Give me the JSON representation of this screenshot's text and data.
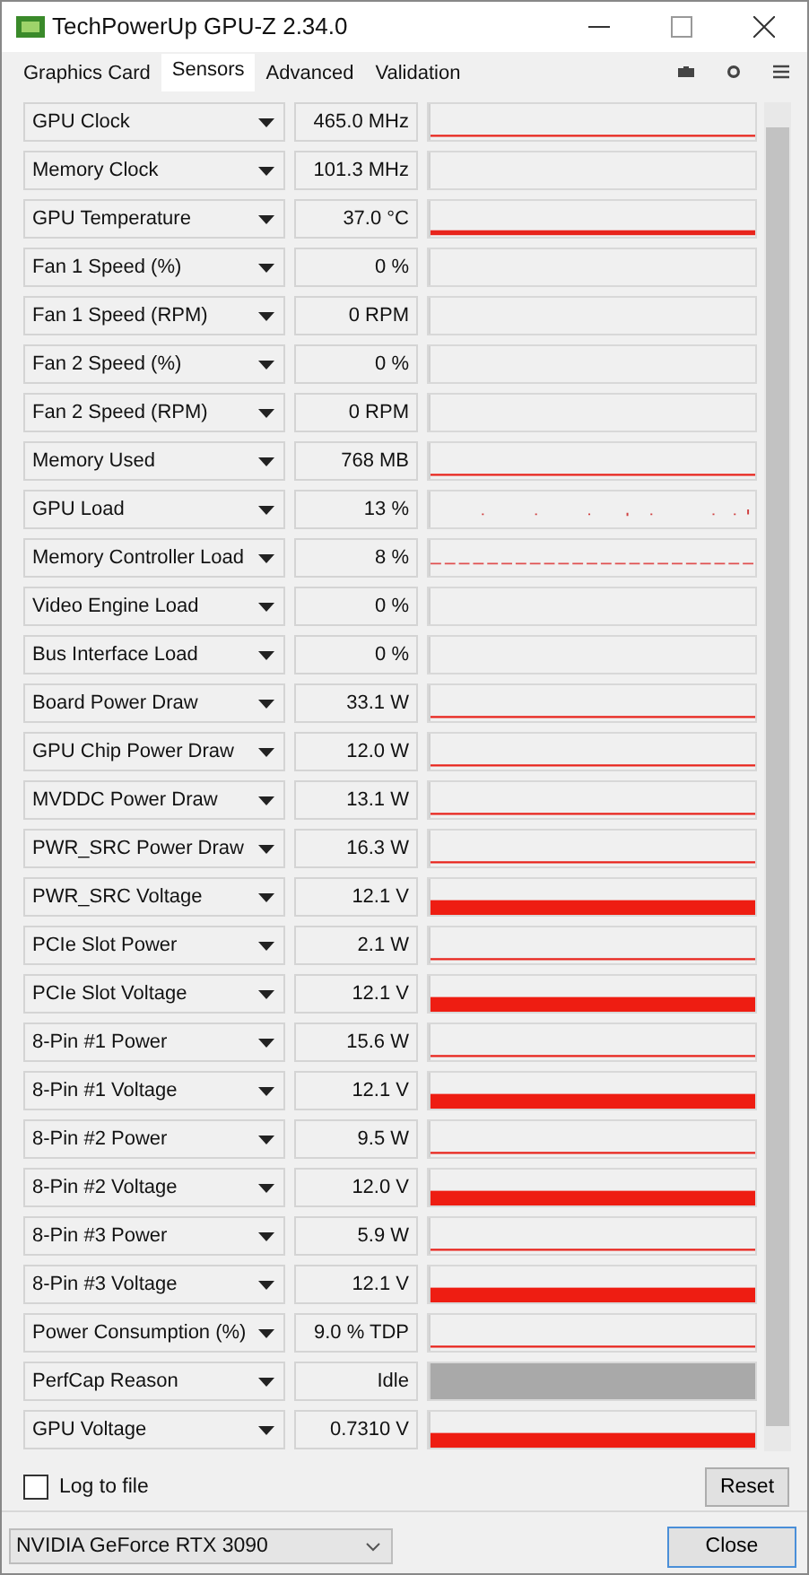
{
  "window": {
    "title": "TechPowerUp GPU-Z 2.34.0"
  },
  "tabs": [
    {
      "label": "Graphics Card",
      "selected": false
    },
    {
      "label": "Sensors",
      "selected": true
    },
    {
      "label": "Advanced",
      "selected": false
    },
    {
      "label": "Validation",
      "selected": false
    }
  ],
  "sensors": [
    {
      "name": "GPU Clock",
      "value": "465.0 MHz",
      "kind": "line"
    },
    {
      "name": "Memory Clock",
      "value": "101.3 MHz",
      "kind": "empty"
    },
    {
      "name": "GPU Temperature",
      "value": "37.0 °C",
      "kind": "thick"
    },
    {
      "name": "Fan 1 Speed (%)",
      "value": "0 %",
      "kind": "empty"
    },
    {
      "name": "Fan 1 Speed (RPM)",
      "value": "0 RPM",
      "kind": "empty"
    },
    {
      "name": "Fan 2 Speed (%)",
      "value": "0 %",
      "kind": "empty"
    },
    {
      "name": "Fan 2 Speed (RPM)",
      "value": "0 RPM",
      "kind": "empty"
    },
    {
      "name": "Memory Used",
      "value": "768 MB",
      "kind": "line"
    },
    {
      "name": "GPU Load",
      "value": "13 %",
      "kind": "dots"
    },
    {
      "name": "Memory Controller Load",
      "value": "8 %",
      "kind": "dashes"
    },
    {
      "name": "Video Engine Load",
      "value": "0 %",
      "kind": "empty"
    },
    {
      "name": "Bus Interface Load",
      "value": "0 %",
      "kind": "empty"
    },
    {
      "name": "Board Power Draw",
      "value": "33.1 W",
      "kind": "line"
    },
    {
      "name": "GPU Chip Power Draw",
      "value": "12.0 W",
      "kind": "line"
    },
    {
      "name": "MVDDC Power Draw",
      "value": "13.1 W",
      "kind": "line"
    },
    {
      "name": "PWR_SRC Power Draw",
      "value": "16.3 W",
      "kind": "line"
    },
    {
      "name": "PWR_SRC Voltage",
      "value": "12.1 V",
      "kind": "bar"
    },
    {
      "name": "PCIe Slot Power",
      "value": "2.1 W",
      "kind": "line"
    },
    {
      "name": "PCIe Slot Voltage",
      "value": "12.1 V",
      "kind": "bar"
    },
    {
      "name": "8-Pin #1 Power",
      "value": "15.6 W",
      "kind": "line"
    },
    {
      "name": "8-Pin #1 Voltage",
      "value": "12.1 V",
      "kind": "bar"
    },
    {
      "name": "8-Pin #2 Power",
      "value": "9.5 W",
      "kind": "line"
    },
    {
      "name": "8-Pin #2 Voltage",
      "value": "12.0 V",
      "kind": "bar"
    },
    {
      "name": "8-Pin #3 Power",
      "value": "5.9 W",
      "kind": "line"
    },
    {
      "name": "8-Pin #3 Voltage",
      "value": "12.1 V",
      "kind": "bar"
    },
    {
      "name": "Power Consumption (%)",
      "value": "9.0 % TDP",
      "kind": "line"
    },
    {
      "name": "PerfCap Reason",
      "value": "Idle",
      "kind": "gray"
    },
    {
      "name": "GPU Voltage",
      "value": "0.7310 V",
      "kind": "bar"
    }
  ],
  "log_to_file": {
    "label": "Log to file",
    "checked": false
  },
  "reset_button": "Reset",
  "gpu_select": "NVIDIA GeForce RTX 3090",
  "close_button": "Close"
}
